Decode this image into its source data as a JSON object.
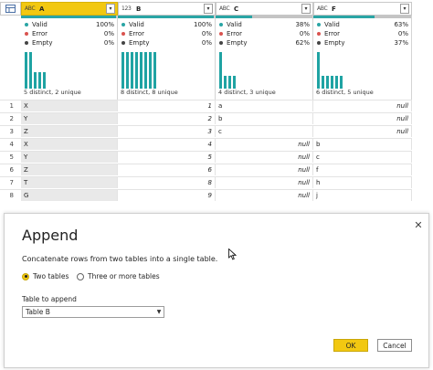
{
  "colors": {
    "accent": "#f2c811",
    "valid": "#2aa5a5",
    "error": "#d9534f",
    "empty": "#444444"
  },
  "grid": {
    "columns": [
      {
        "type_icon": "Aᴮᶜ",
        "type_text": "ABC",
        "name": "A",
        "active": true,
        "valid_label": "Valid",
        "valid_pct": "100%",
        "error_label": "Error",
        "error_pct": "0%",
        "empty_label": "Empty",
        "empty_pct": "0%",
        "valid_frac": 1.0,
        "distinct": "5 distinct, 2 unique",
        "bars": [
          1,
          1,
          0.45,
          0.45,
          0.45
        ]
      },
      {
        "type_text": "123",
        "name": "B",
        "active": false,
        "valid_label": "Valid",
        "valid_pct": "100%",
        "error_label": "Error",
        "error_pct": "0%",
        "empty_label": "Empty",
        "empty_pct": "0%",
        "valid_frac": 1.0,
        "distinct": "8 distinct, 8 unique",
        "bars": [
          1,
          1,
          1,
          1,
          1,
          1,
          1,
          1
        ]
      },
      {
        "type_text": "ABC",
        "name": "C",
        "active": false,
        "valid_label": "Valid",
        "valid_pct": "38%",
        "error_label": "Error",
        "error_pct": "0%",
        "empty_label": "Empty",
        "empty_pct": "62%",
        "valid_frac": 0.38,
        "distinct": "4 distinct, 3 unique",
        "bars": [
          1,
          0.35,
          0.35,
          0.35
        ]
      },
      {
        "type_text": "ABC",
        "name": "F",
        "active": false,
        "valid_label": "Valid",
        "valid_pct": "63%",
        "error_label": "Error",
        "error_pct": "0%",
        "empty_label": "Empty",
        "empty_pct": "37%",
        "valid_frac": 0.63,
        "distinct": "6 distinct, 5 unique",
        "bars": [
          1,
          0.35,
          0.35,
          0.35,
          0.35,
          0.35
        ]
      }
    ],
    "rows": [
      {
        "n": "1",
        "A": "X",
        "B": "1",
        "C": "a",
        "F": "null"
      },
      {
        "n": "2",
        "A": "Y",
        "B": "2",
        "C": "b",
        "F": "null"
      },
      {
        "n": "3",
        "A": "Z",
        "B": "3",
        "C": "c",
        "F": "null"
      },
      {
        "n": "4",
        "A": "X",
        "B": "4",
        "C": "null",
        "F": "b"
      },
      {
        "n": "5",
        "A": "Y",
        "B": "5",
        "C": "null",
        "F": "c"
      },
      {
        "n": "6",
        "A": "Z",
        "B": "6",
        "C": "null",
        "F": "f"
      },
      {
        "n": "7",
        "A": "T",
        "B": "8",
        "C": "null",
        "F": "h"
      },
      {
        "n": "8",
        "A": "G",
        "B": "9",
        "C": "null",
        "F": "j"
      }
    ]
  },
  "dialog": {
    "title": "Append",
    "description": "Concatenate rows from two tables into a single table.",
    "radio_two": "Two tables",
    "radio_more": "Three or more tables",
    "table_to_append_label": "Table to append",
    "table_to_append_value": "Table B",
    "ok_label": "OK",
    "cancel_label": "Cancel"
  }
}
